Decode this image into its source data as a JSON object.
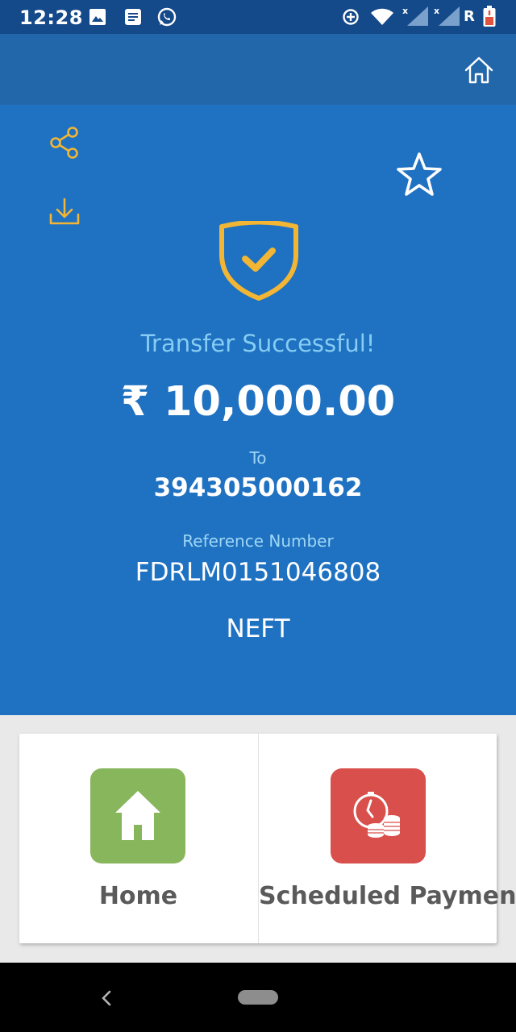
{
  "status_bar": {
    "time": "12:28",
    "network_label": "R",
    "icons": [
      "gallery-icon",
      "message-icon",
      "whatsapp-icon",
      "data-saver-icon",
      "wifi-icon",
      "signal-icon",
      "signal-icon",
      "battery-icon"
    ]
  },
  "header": {
    "home_icon": "home-outline-icon"
  },
  "hero": {
    "share_icon": "share-icon",
    "download_icon": "download-icon",
    "favorite_icon": "star-outline-icon",
    "status_icon": "shield-check-icon",
    "status_message": "Transfer Successful!",
    "amount": "₹ 10,000.00",
    "to_label": "To",
    "to_account": "394305000162",
    "reference_label": "Reference Number",
    "reference_number": "FDRLM0151046808",
    "mode": "NEFT"
  },
  "actions": [
    {
      "label": "Home",
      "icon": "home-icon",
      "color": "#88b65c"
    },
    {
      "label": "Scheduled Payment",
      "icon": "clock-coins-icon",
      "color": "#d84f4c"
    }
  ],
  "colors": {
    "status_bar": "#14498a",
    "header": "#2367ab",
    "hero": "#1f71c1",
    "accent_gold": "#f2b634"
  }
}
